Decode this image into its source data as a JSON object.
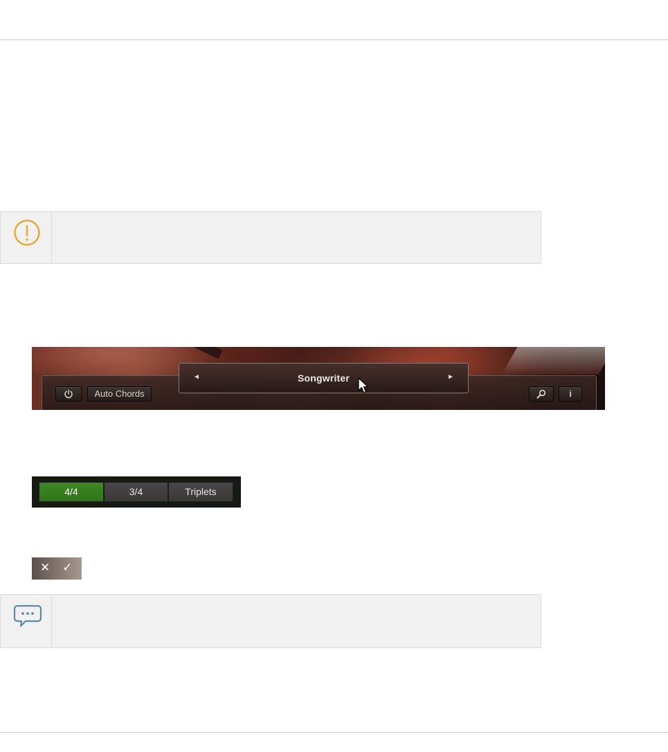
{
  "header_bar": {
    "auto_chords_label": "Auto Chords",
    "preset_name": "Songwriter",
    "prev_arrow": "◄",
    "next_arrow": "►",
    "info_label": "i",
    "icons": [
      "power-icon",
      "magnifier-icon",
      "mouse-pointer-icon"
    ]
  },
  "time_signature": {
    "options": [
      "4/4",
      "3/4",
      "Triplets"
    ],
    "selected": "4/4",
    "active_color": "#37801d"
  },
  "confirm_controls": {
    "cancel_symbol": "✕",
    "confirm_symbol": "✓"
  },
  "callouts": {
    "warning_icon": "exclamation-circle-icon",
    "warning_color": "#e8a838",
    "note_icon": "speech-bubble-icon",
    "note_color": "#5b8aa6"
  }
}
